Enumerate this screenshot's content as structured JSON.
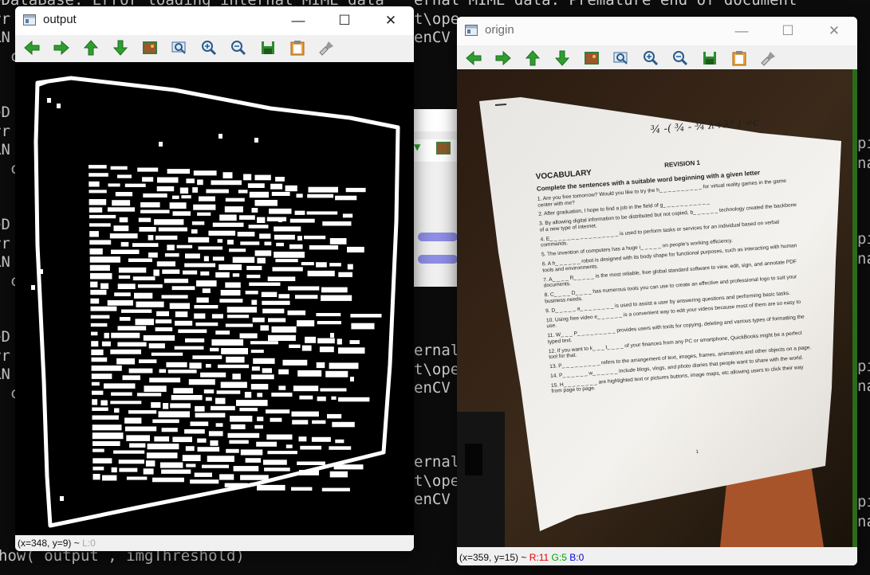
{
  "terminal": {
    "lines": [
      "eDataBase: Error loading internal MIME data",
      "rr",
      "RN",
      "  c",
      "",
      ")",
      "eD",
      "rr",
      "RN",
      "  c",
      "",
      ")",
      "eD",
      "rr",
      "RN",
      "  c",
      "",
      ")",
      "eD",
      "rr",
      "RN",
      "  c"
    ],
    "right_fragments": [
      "ernal MIME data: Premature end of document",
      "t\\ope",
      "enCV"
    ],
    "edge_chars": [
      "pi",
      "na"
    ],
    "bottom_line": "how( output , imgThreshold)"
  },
  "windows": [
    {
      "id": "output",
      "title": "output",
      "status": {
        "coords": "(x=348, y=9) ~",
        "value": "L:0"
      },
      "controls": {
        "minimize": "—",
        "maximize": "☐",
        "close": "✕"
      },
      "toolbar": [
        "arrow-left-icon",
        "arrow-right-icon",
        "arrow-up-icon",
        "arrow-down-icon",
        "image-icon",
        "zoom-fit-icon",
        "zoom-in-icon",
        "zoom-out-icon",
        "save-icon",
        "clipboard-icon",
        "brush-icon"
      ]
    },
    {
      "id": "origin",
      "title": "origin",
      "status": {
        "coords": "(x=359, y=15) ~",
        "r": "R:11",
        "g": "G:5",
        "b": "B:0"
      },
      "controls": {
        "minimize": "—",
        "maximize": "☐",
        "close": "✕"
      },
      "toolbar": [
        "arrow-left-icon",
        "arrow-right-icon",
        "arrow-up-icon",
        "arrow-down-icon",
        "image-icon",
        "zoom-fit-icon",
        "zoom-in-icon",
        "zoom-out-icon",
        "save-icon",
        "clipboard-icon",
        "brush-icon"
      ]
    }
  ],
  "document": {
    "formula": "¾ -( ¾ - ¾ λ+λ² ) =c",
    "heading": "VOCABULARY",
    "revision": "REVISION 1",
    "instruction": "Complete the sentences with a suitable word beginning with a given letter",
    "items": [
      "1. Are you free tomorrow? Would you like to try the h_ _ _ _ _ _ _ _ _ _ for virtual reality games in the game center with me?",
      "2. After graduation, I hope to find a job in the field of g_ _ _ _ _ _ _ _ _ _ _",
      "3. By allowing digital information to be distributed but not copied, b_ _ _ _ _ _ technology created the backbone of a new type of internet.",
      "4. E_ _ _ _ _ _ _ _ _ _ _ _ _ _ _ _ is used to perform tasks or services for an individual based on verbal commands.",
      "5. The invention of computers has a huge i_ _ _ _ _ on people's working efficiency.",
      "6. A h_ _ _ _ _ _ robot is designed with its body shape for functional purposes, such as interacting with human tools and environments.",
      "7. A_ _ _ _ R_ _ _ _ _ is the most reliable, free global standard software to view, edit, sign, and annotate PDF documents.",
      "8. C_ _ _ _ D_ _ _ _ has numerous tools you can use to create an effective and professional logo to suit your business needs.",
      "9. D_ _ _ _ _ a_ _ _ _ _ _ _ _ is used to assist a user by answering questions and performing basic tasks.",
      "10. Using free video e_ _ _ _ _ _ is a convenient way to edit your videos because most of them are so easy to use.",
      "11. W_ _ _ P_ _ _ _ _ _ _ _ _ provides users with tools for copying, deleting and various types of formatting the typed text.",
      "12. If you want to k_ _ _ t_ _ _ _ of your finances from any PC or smartphone, QuickBooks might be a perfect tool for that.",
      "13. P_ _ _ _ _ _ _ _ _ refers to the arrangement of text, images, frames, animations and other objects on a page.",
      "14. P_ _ _ _ _ _ w_ _ _ _ _ _ include blogs, vlogs, and photo diaries that people want to share with the world.",
      "15. H_ _ _ _ _ _ _ _ are highlighted text or pictures buttons, image maps, etc allowing users to click their way from page to page."
    ],
    "page_number": "1"
  }
}
